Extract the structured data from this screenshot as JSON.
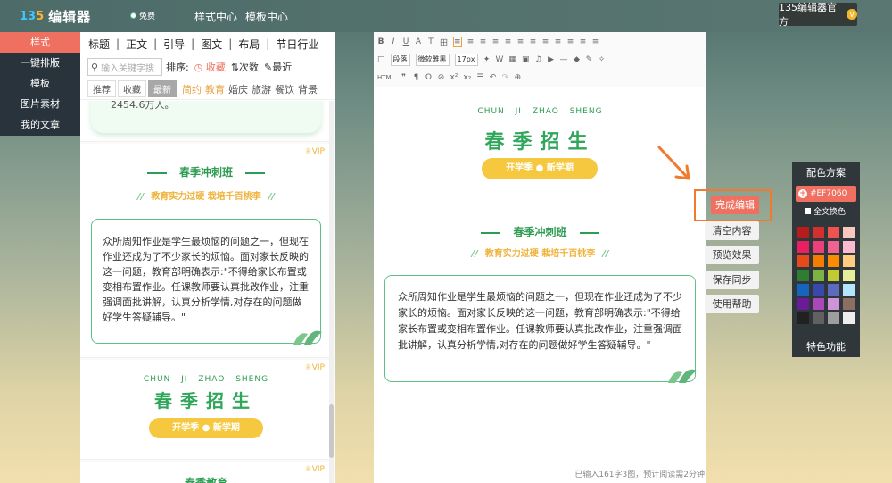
{
  "topbar": {
    "logo_mark_a": "13",
    "logo_mark_b": "5",
    "logo_text": "编辑器",
    "free_label": "免费",
    "nav": [
      "样式中心",
      "模板中心"
    ],
    "account": "135编辑器官方",
    "account_badge": "V"
  },
  "leftnav": {
    "items": [
      {
        "label": "样式",
        "active": true
      },
      {
        "label": "一键排版"
      },
      {
        "label": "模板"
      },
      {
        "label": "图片素材"
      },
      {
        "label": "我的文章"
      }
    ]
  },
  "panel": {
    "categories": [
      "标题",
      "正文",
      "引导",
      "图文",
      "布局",
      "节日行业"
    ],
    "search_placeholder": "输入关键字搜",
    "sort_label": "排序:",
    "sort_options": [
      "收藏",
      "次数",
      "最近"
    ],
    "tabs": [
      "推荐",
      "收藏",
      "最新"
    ],
    "active_tab": "最新",
    "tags": [
      "简约",
      "教育",
      "婚庆",
      "旅游",
      "餐饮",
      "背景"
    ],
    "colored_tags": [
      "简约",
      "教育"
    ],
    "list": {
      "top_fragment": "2454.6万人。",
      "vip": "VIP",
      "title": "春季冲刺班",
      "subtitle": "教育实力过硬 栽培千百桃李",
      "body": "众所周知作业是学生最烦恼的问题之一，但现在作业还成为了不少家长的烦恼。面对家长反映的这一问题，教育部明确表示:\"不得给家长布置或变相布置作业。任课教师要认真批改作业，注重强调面批讲解，认真分析学情,对存在的问题做好学生答疑辅导。\"",
      "pinyin": "CHUN JI ZHAO SHENG",
      "big_title": "春季招生",
      "pill": "开学季 ● 新学期",
      "bottom_title": "春季教育"
    }
  },
  "editor": {
    "toolbar": {
      "row1": [
        "B",
        "I",
        "U",
        "A",
        "T",
        "田",
        "≡",
        "≡",
        "≡",
        "≡",
        "≡",
        "≡",
        "≡",
        "≡",
        "≡",
        "≡",
        "≡",
        "≡"
      ],
      "style_select": "段落",
      "font_select": "微软雅黑",
      "size_select": "17px",
      "row2": [
        "W",
        "▦",
        "▣",
        "♫",
        "▶",
        "—",
        "◆",
        "✎",
        "✧"
      ],
      "row3": [
        "HTML",
        "❞",
        "¶",
        "Ω",
        "⊘",
        "x²",
        "x₂",
        "☰",
        "↶",
        "↷",
        "⊕"
      ]
    },
    "pinyin": "CHUN JI ZHAO SHENG",
    "big_title": "春季招生",
    "pill": "开学季 ● 新学期",
    "title": "春季冲刺班",
    "subtitle": "教育实力过硬 栽培千百桃李",
    "body": "众所周知作业是学生最烦恼的问题之一，但现在作业还成为了不少家长的烦恼。面对家长反映的这一问题，教育部明确表示:\"不得给家长布置或变相布置作业。任课教师要认真批改作业，注重强调面批讲解，认真分析学情,对存在的问题做好学生答疑辅导。\"",
    "word_count": "已输入161字3图，预计阅读需2分钟"
  },
  "side_actions": {
    "done": "完成编辑",
    "others": [
      "清空内容",
      "预览效果",
      "保存同步",
      "使用帮助"
    ]
  },
  "color_scheme": {
    "title": "配色方案",
    "current_hex": "#EF7060",
    "replace_all": "全文换色",
    "footer": "特色功能",
    "swatches": [
      "#b71c1c",
      "#d32f2f",
      "#ef5350",
      "#f6c8bf",
      "#e91e63",
      "#ec407a",
      "#f06292",
      "#f8bbd0",
      "#e64a19",
      "#f57c00",
      "#fb8c00",
      "#ffcc80",
      "#2e7d32",
      "#7cb342",
      "#c0ca33",
      "#e6ee9c",
      "#1565c0",
      "#3949ab",
      "#5c6bc0",
      "#b3e5fc",
      "#6a1b9a",
      "#ab47bc",
      "#ce93d8",
      "#8d6e63",
      "#212121",
      "#616161",
      "#9e9e9e",
      "#eeeeee"
    ],
    "accent": "#EF7060",
    "brand_green": "#2e9c52"
  }
}
